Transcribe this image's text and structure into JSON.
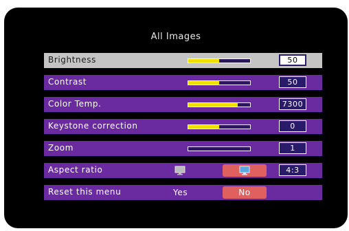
{
  "menu": {
    "title": "All Images",
    "rows": [
      {
        "label": "Brightness",
        "value": "50",
        "level": 0.5
      },
      {
        "label": "Contrast",
        "value": "50",
        "level": 0.5
      },
      {
        "label": "Color Temp.",
        "value": "7300",
        "level": 0.8
      },
      {
        "label": "Keystone correction",
        "value": "0",
        "level": 0.5
      },
      {
        "label": "Zoom",
        "value": "1",
        "level": 0.0
      },
      {
        "label": "Aspect ratio",
        "value": "4:3"
      },
      {
        "label": "Reset this menu",
        "yes": "Yes",
        "no": "No"
      }
    ]
  },
  "icons": {
    "aspect_wide": "monitor-icon",
    "aspect_standard": "monitor-icon"
  },
  "colors": {
    "row_bg": "#6a2aa0",
    "selected_bg": "#c4c4c4",
    "slider_fill": "#f0e000",
    "option_highlight": "#e06060"
  }
}
